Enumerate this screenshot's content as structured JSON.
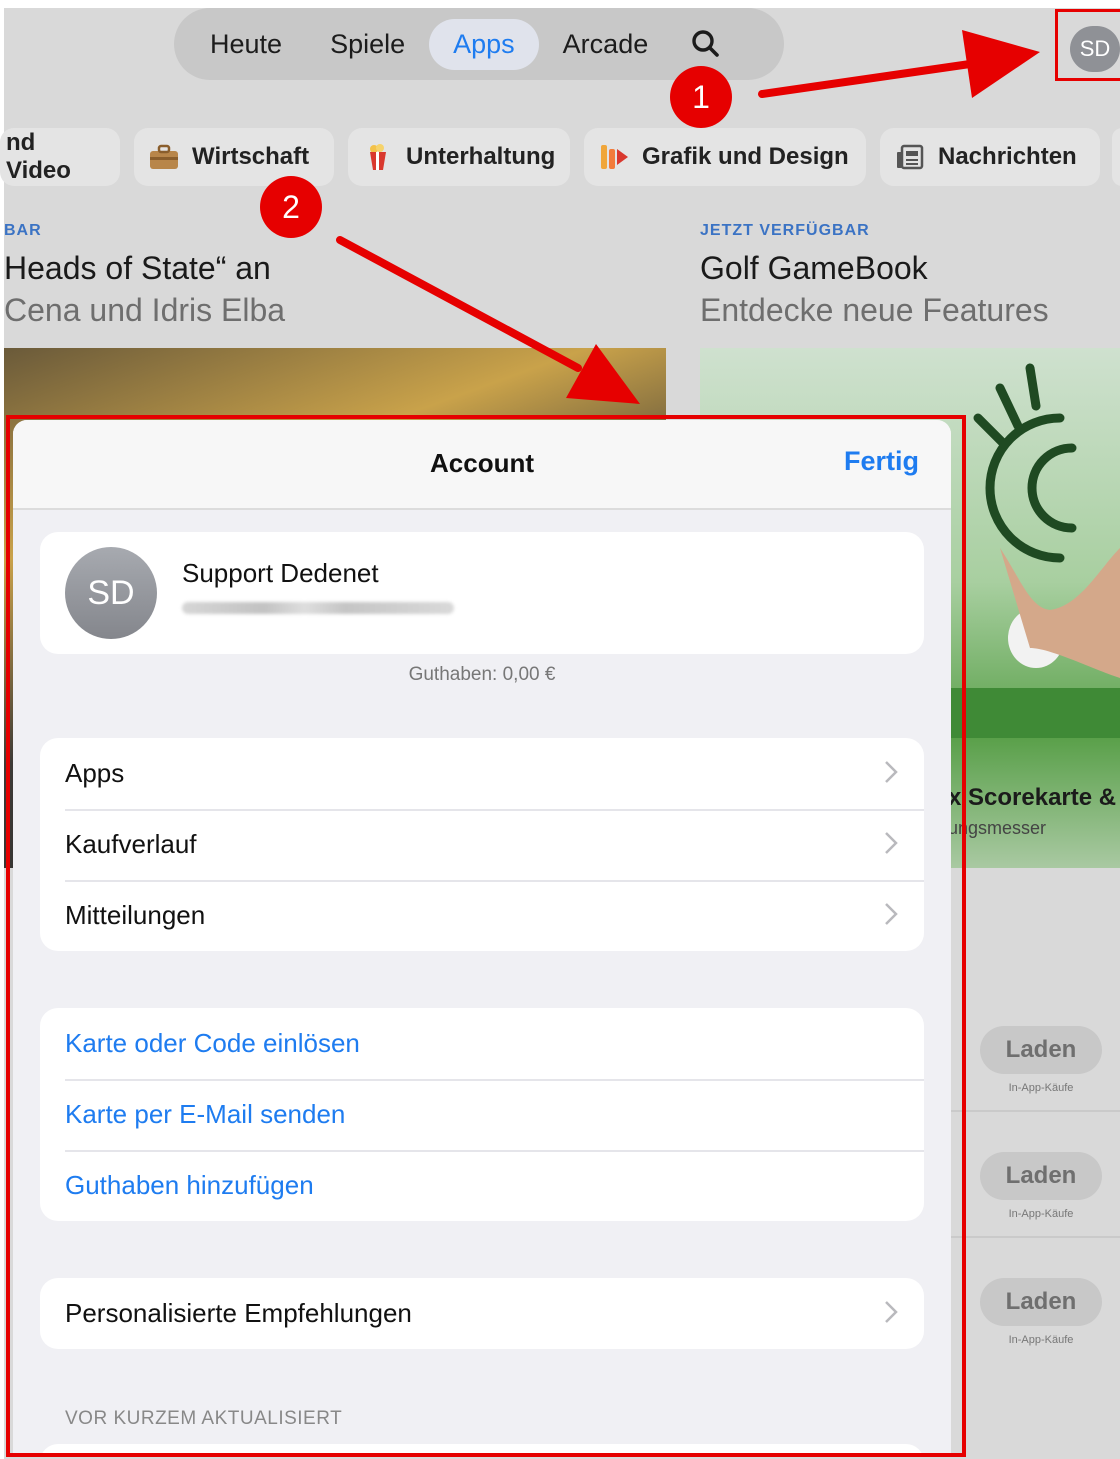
{
  "tabs": [
    {
      "label": "Heute",
      "active": false
    },
    {
      "label": "Spiele",
      "active": false
    },
    {
      "label": "Apps",
      "active": true
    },
    {
      "label": "Arcade",
      "active": false
    }
  ],
  "avatar_initials": "SD",
  "categories": [
    "nd Video",
    "Wirtschaft",
    "Unterhaltung",
    "Grafik und Design",
    "Nachrichten"
  ],
  "featured": [
    {
      "eyebrow": "BAR",
      "title": "Heads of State“ an",
      "subtitle": "Cena und Idris Elba"
    },
    {
      "eyebrow": "JETZT VERFÜGBAR",
      "title": "Golf GameBook",
      "subtitle": "Entdecke neue Features"
    }
  ],
  "background_text": {
    "score": "x Scorekarte &",
    "score_sub": "ungsmesser",
    "get_label": "Laden",
    "iap_label": "In-App-Käufe"
  },
  "markers": [
    "1",
    "2"
  ],
  "sheet": {
    "title": "Account",
    "done": "Fertig",
    "user_name": "Support Dedenet",
    "balance": "Guthaben: 0,00 €",
    "group1": [
      "Apps",
      "Kaufverlauf",
      "Mitteilungen"
    ],
    "group2": [
      "Karte oder Code einlösen",
      "Karte per E-Mail senden",
      "Guthaben hinzufügen"
    ],
    "group3": [
      "Personalisierte Empfehlungen"
    ],
    "section_header": "VOR KURZEM AKTUALISIERT"
  },
  "colors": {
    "accent": "#1e7cf0",
    "annotation": "#e60000"
  }
}
